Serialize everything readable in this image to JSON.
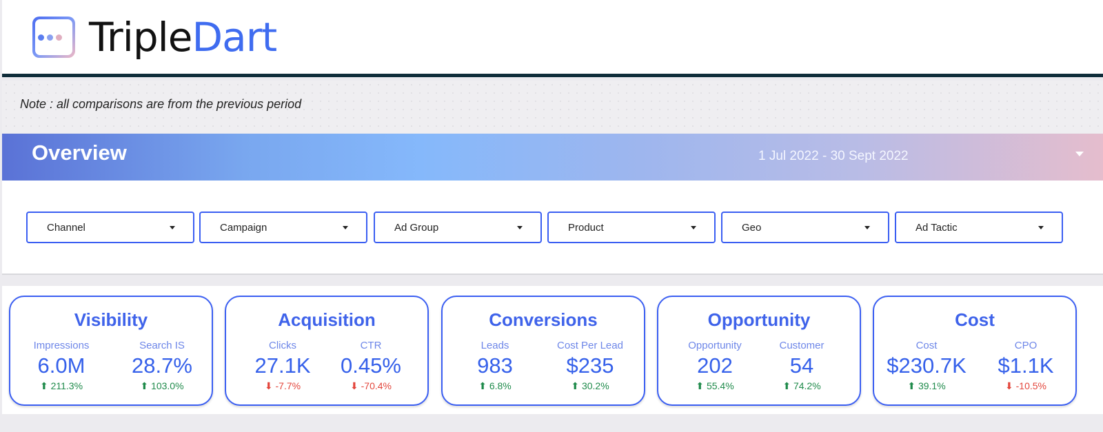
{
  "logo": {
    "text_primary": "Triple",
    "text_accent": "Dart",
    "icon": "three-dots-logo-icon",
    "dot_colors": [
      "#5a7df0",
      "#8aa0f0",
      "#e0aec0"
    ]
  },
  "note": "Note : all comparisons are from the previous period",
  "overview": {
    "title": "Overview",
    "date_range": "1 Jul 2022 - 30 Sept 2022"
  },
  "filters": [
    {
      "label": "Channel"
    },
    {
      "label": "Campaign"
    },
    {
      "label": "Ad Group"
    },
    {
      "label": "Product"
    },
    {
      "label": "Geo"
    },
    {
      "label": "Ad Tactic"
    }
  ],
  "cards": [
    {
      "title": "Visibility",
      "metrics": [
        {
          "label": "Impressions",
          "value": "6.0M",
          "change": "211.3%",
          "direction": "up"
        },
        {
          "label": "Search IS",
          "value": "28.7%",
          "change": "103.0%",
          "direction": "up"
        }
      ]
    },
    {
      "title": "Acquisition",
      "metrics": [
        {
          "label": "Clicks",
          "value": "27.1K",
          "change": "-7.7%",
          "direction": "down"
        },
        {
          "label": "CTR",
          "value": "0.45%",
          "change": "-70.4%",
          "direction": "down"
        }
      ]
    },
    {
      "title": "Conversions",
      "metrics": [
        {
          "label": "Leads",
          "value": "983",
          "change": "6.8%",
          "direction": "up"
        },
        {
          "label": "Cost Per Lead",
          "value": "$235",
          "change": "30.2%",
          "direction": "up"
        }
      ]
    },
    {
      "title": "Opportunity",
      "metrics": [
        {
          "label": "Opportunity",
          "value": "202",
          "change": "55.4%",
          "direction": "up"
        },
        {
          "label": "Customer",
          "value": "54",
          "change": "74.2%",
          "direction": "up"
        }
      ]
    },
    {
      "title": "Cost",
      "metrics": [
        {
          "label": "Cost",
          "value": "$230.7K",
          "change": "39.1%",
          "direction": "up"
        },
        {
          "label": "CPO",
          "value": "$1.1K",
          "change": "-10.5%",
          "direction": "down"
        }
      ]
    }
  ],
  "colors": {
    "accent": "#3a5ef2",
    "positive": "#1e8a4a",
    "negative": "#e3453b",
    "header_rule": "#0f2d3a"
  }
}
